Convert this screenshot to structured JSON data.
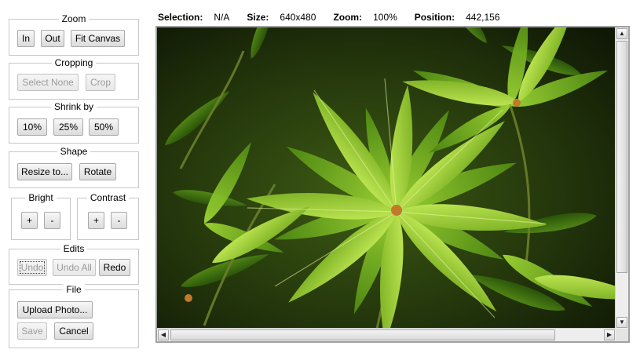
{
  "zoom": {
    "title": "Zoom",
    "in_label": "In",
    "out_label": "Out",
    "fit_label": "Fit Canvas"
  },
  "cropping": {
    "title": "Cropping",
    "select_none_label": "Select None",
    "crop_label": "Crop"
  },
  "shrink": {
    "title": "Shrink by",
    "p10_label": "10%",
    "p25_label": "25%",
    "p50_label": "50%"
  },
  "shape": {
    "title": "Shape",
    "resize_label": "Resize to...",
    "rotate_label": "Rotate"
  },
  "bright": {
    "title": "Bright",
    "plus_label": "+",
    "minus_label": "-"
  },
  "contrast": {
    "title": "Contrast",
    "plus_label": "+",
    "minus_label": "-"
  },
  "edits": {
    "title": "Edits",
    "undo_label": "Undo",
    "undo_all_label": "Undo All",
    "redo_label": "Redo"
  },
  "file": {
    "title": "File",
    "upload_label": "Upload Photo...",
    "save_label": "Save",
    "cancel_label": "Cancel"
  },
  "status": {
    "selection_label": "Selection:",
    "selection_value": "N/A",
    "size_label": "Size:",
    "size_value": "640x480",
    "zoom_label": "Zoom:",
    "zoom_value": "100%",
    "position_label": "Position:",
    "position_value": "442,156"
  },
  "viewer": {
    "image_subject": "green leafy plant photo"
  },
  "icons": {
    "scroll_up": "up-arrow-icon",
    "scroll_down": "down-arrow-icon",
    "scroll_left": "left-arrow-icon",
    "scroll_right": "right-arrow-icon"
  }
}
